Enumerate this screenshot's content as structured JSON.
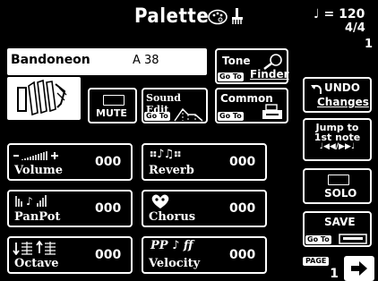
{
  "header": {
    "title": "Palette",
    "tempo": "♩ = 120",
    "time_signature": "4/4",
    "measure": "1"
  },
  "instrument": {
    "name": "Bandoneon",
    "bank": "A 38"
  },
  "buttons": {
    "tone_finder": {
      "line1": "Tone",
      "line2": "Finder",
      "goto": "Go To"
    },
    "mute": "MUTE",
    "sound_edit": {
      "label": "Sound Edit",
      "goto": "Go To"
    },
    "common": {
      "label": "Common",
      "goto": "Go To"
    },
    "undo": {
      "line1": "UNDO",
      "line2": "Changes"
    },
    "jump": {
      "line1": "Jump to",
      "line2": "1st note",
      "line3": "♩◀◀/▶▶♩"
    },
    "solo": "SOLO",
    "save": {
      "label": "SAVE",
      "goto": "Go To"
    },
    "page": {
      "label": "PAGE",
      "number": "1"
    }
  },
  "params": {
    "volume": {
      "label": "Volume",
      "value": "000"
    },
    "reverb": {
      "label": "Reverb",
      "value": "000"
    },
    "panpot": {
      "label": "PanPot",
      "value": "000"
    },
    "chorus": {
      "label": "Chorus",
      "value": "000"
    },
    "octave": {
      "label": "Octave",
      "value": "000"
    },
    "velocity": {
      "label": "Velocity",
      "value": "000",
      "icon_text": "PP ♪ ff"
    }
  }
}
